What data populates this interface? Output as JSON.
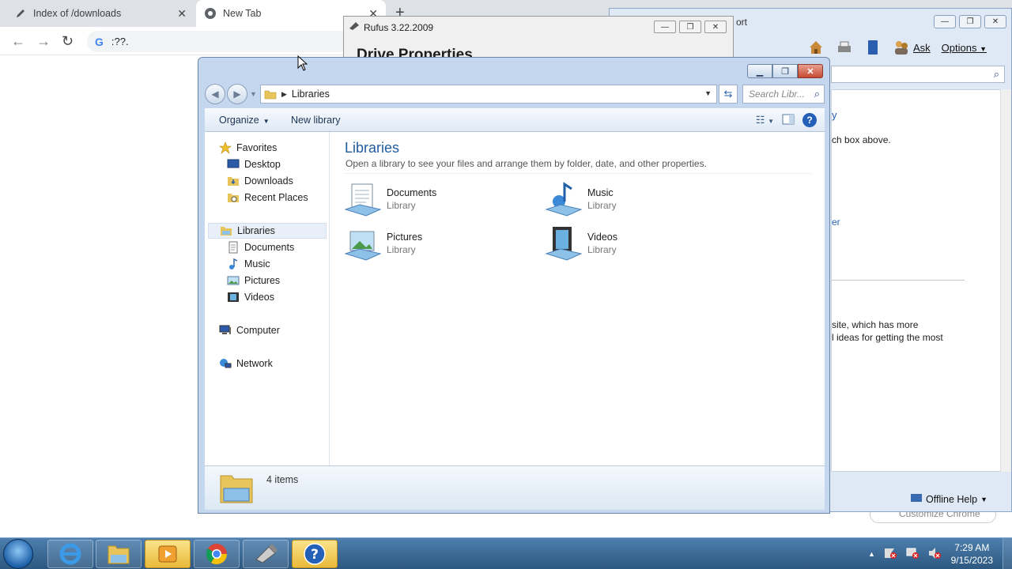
{
  "chrome": {
    "tabs": [
      {
        "title": "Index of /downloads"
      },
      {
        "title": "New Tab"
      }
    ],
    "tab_close": "✕",
    "new_tab": "+",
    "omnibox_value": ":??.",
    "omnibox_g": "G",
    "back": "←",
    "forward": "→",
    "reload": "↻",
    "customize": "Customize Chrome"
  },
  "help_window": {
    "title": "ort",
    "toolbar": {
      "ask": "Ask",
      "options": "Options"
    },
    "content_lines": [
      {
        "text": "y",
        "link": true
      },
      {
        "text": "ch box above.",
        "link": false
      },
      {
        "text": "er",
        "link": true
      },
      {
        "text": "site, which has more",
        "link": false
      },
      {
        "text": "l ideas for getting the most",
        "link": false
      }
    ],
    "footer": "Offline Help"
  },
  "rufus": {
    "title": "Rufus 3.22.2009",
    "heading": "Drive Properties"
  },
  "explorer": {
    "address": "Libraries",
    "search_placeholder": "Search Libr...",
    "commands": {
      "organize": "Organize",
      "new_library": "New library"
    },
    "nav": {
      "favorites": "Favorites",
      "desktop": "Desktop",
      "downloads": "Downloads",
      "recent": "Recent Places",
      "libraries": "Libraries",
      "documents": "Documents",
      "music": "Music",
      "pictures": "Pictures",
      "videos": "Videos",
      "computer": "Computer",
      "network": "Network"
    },
    "content": {
      "title": "Libraries",
      "subtitle": "Open a library to see your files and arrange them by folder, date, and other properties.",
      "libraries": [
        {
          "name": "Documents",
          "type": "Library"
        },
        {
          "name": "Music",
          "type": "Library"
        },
        {
          "name": "Pictures",
          "type": "Library"
        },
        {
          "name": "Videos",
          "type": "Library"
        }
      ]
    },
    "status": "4 items"
  },
  "taskbar": {
    "time": "7:29 AM",
    "date": "9/15/2023",
    "tray_arrow": "▲"
  }
}
